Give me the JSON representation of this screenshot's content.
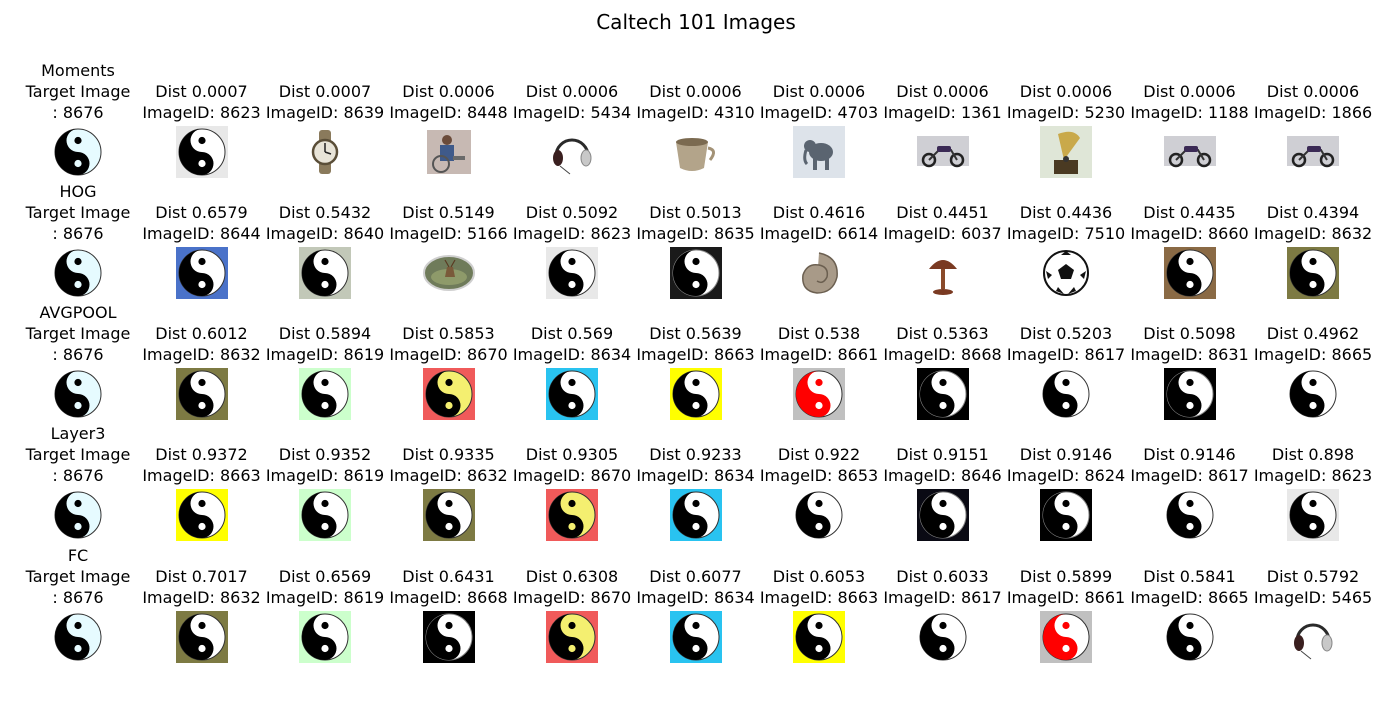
{
  "title": "Caltech 101 Images",
  "rows": [
    {
      "method": "Moments",
      "target": {
        "l1": "Target Image",
        "l2": ": 8676",
        "icon": "yinyang-icon",
        "bg": "#ffffff"
      },
      "results": [
        {
          "dist": "Dist 0.0007",
          "id": "ImageID: 8623",
          "icon": "yinyang-icon",
          "bg": "#e8e8e8"
        },
        {
          "dist": "Dist 0.0007",
          "id": "ImageID: 8639",
          "icon": "wristwatch-icon",
          "bg": "#ffffff"
        },
        {
          "dist": "Dist 0.0006",
          "id": "ImageID: 8448",
          "icon": "wheelchair-photo-icon",
          "bg": "#ffffff"
        },
        {
          "dist": "Dist 0.0006",
          "id": "ImageID: 5434",
          "icon": "headphones-icon",
          "bg": "#ffffff"
        },
        {
          "dist": "Dist 0.0006",
          "id": "ImageID: 4310",
          "icon": "cup-icon",
          "bg": "#ffffff"
        },
        {
          "dist": "Dist 0.0006",
          "id": "ImageID: 4703",
          "icon": "elephant-icon",
          "bg": "#dde3ea"
        },
        {
          "dist": "Dist 0.0006",
          "id": "ImageID: 1361",
          "icon": "motorbike-icon",
          "bg": "#ffffff"
        },
        {
          "dist": "Dist 0.0006",
          "id": "ImageID: 5230",
          "icon": "gramophone-icon",
          "bg": "#dfe6d7"
        },
        {
          "dist": "Dist 0.0006",
          "id": "ImageID: 1188",
          "icon": "motorbike-icon",
          "bg": "#ffffff"
        },
        {
          "dist": "Dist 0.0006",
          "id": "ImageID: 1866",
          "icon": "motorbike-icon",
          "bg": "#ffffff"
        }
      ]
    },
    {
      "method": "HOG",
      "target": {
        "l1": "Target Image",
        "l2": ": 8676",
        "icon": "yinyang-icon",
        "bg": "#ffffff"
      },
      "results": [
        {
          "dist": "Dist 0.6579",
          "id": "ImageID: 8644",
          "icon": "yinyang-icon",
          "bg": "#4a72c9"
        },
        {
          "dist": "Dist 0.5432",
          "id": "ImageID: 8640",
          "icon": "yinyang-icon",
          "bg": "#c2c8b8"
        },
        {
          "dist": "Dist 0.5149",
          "id": "ImageID: 5166",
          "icon": "deer-plate-icon",
          "bg": "#ffffff"
        },
        {
          "dist": "Dist 0.5092",
          "id": "ImageID: 8623",
          "icon": "yinyang-icon",
          "bg": "#e8e8e8"
        },
        {
          "dist": "Dist 0.5013",
          "id": "ImageID: 8635",
          "icon": "yinyang-icon",
          "bg": "#1a1a1a"
        },
        {
          "dist": "Dist 0.4616",
          "id": "ImageID: 6614",
          "icon": "nautilus-icon",
          "bg": "#ffffff"
        },
        {
          "dist": "Dist 0.4451",
          "id": "ImageID: 6037",
          "icon": "lamp-icon",
          "bg": "#ffffff"
        },
        {
          "dist": "Dist 0.4436",
          "id": "ImageID: 7510",
          "icon": "soccer-ball-icon",
          "bg": "#ffffff"
        },
        {
          "dist": "Dist 0.4435",
          "id": "ImageID: 8660",
          "icon": "yinyang-icon",
          "bg": "#8a6a45"
        },
        {
          "dist": "Dist 0.4394",
          "id": "ImageID: 8632",
          "icon": "yinyang-icon",
          "bg": "#7d7a43"
        }
      ]
    },
    {
      "method": "AVGPOOL",
      "target": {
        "l1": "Target Image",
        "l2": ": 8676",
        "icon": "yinyang-icon",
        "bg": "#ffffff"
      },
      "results": [
        {
          "dist": "Dist 0.6012",
          "id": "ImageID: 8632",
          "icon": "yinyang-icon",
          "bg": "#7d7a43"
        },
        {
          "dist": "Dist 0.5894",
          "id": "ImageID: 8619",
          "icon": "yinyang-icon",
          "bg": "#ccffcc"
        },
        {
          "dist": "Dist 0.5853",
          "id": "ImageID: 8670",
          "icon": "yinyang-icon",
          "bg": "#f05a5a"
        },
        {
          "dist": "Dist 0.569",
          "id": "ImageID: 8634",
          "icon": "yinyang-icon",
          "bg": "#29c3f0"
        },
        {
          "dist": "Dist 0.5639",
          "id": "ImageID: 8663",
          "icon": "yinyang-icon",
          "bg": "#ffff00"
        },
        {
          "dist": "Dist 0.538",
          "id": "ImageID: 8661",
          "icon": "yinyang-icon",
          "bg": "#c0c0c0"
        },
        {
          "dist": "Dist 0.5363",
          "id": "ImageID: 8668",
          "icon": "yinyang-icon",
          "bg": "#000000"
        },
        {
          "dist": "Dist 0.5203",
          "id": "ImageID: 8617",
          "icon": "yinyang-icon",
          "bg": "#ffffff"
        },
        {
          "dist": "Dist 0.5098",
          "id": "ImageID: 8631",
          "icon": "yinyang-icon",
          "bg": "#000000"
        },
        {
          "dist": "Dist 0.4962",
          "id": "ImageID: 8665",
          "icon": "yinyang-icon",
          "bg": "#ffffff"
        }
      ]
    },
    {
      "method": "Layer3",
      "target": {
        "l1": "Target Image",
        "l2": ": 8676",
        "icon": "yinyang-icon",
        "bg": "#ffffff"
      },
      "results": [
        {
          "dist": "Dist 0.9372",
          "id": "ImageID: 8663",
          "icon": "yinyang-icon",
          "bg": "#ffff00"
        },
        {
          "dist": "Dist 0.9352",
          "id": "ImageID: 8619",
          "icon": "yinyang-icon",
          "bg": "#ccffcc"
        },
        {
          "dist": "Dist 0.9335",
          "id": "ImageID: 8632",
          "icon": "yinyang-icon",
          "bg": "#7d7a43"
        },
        {
          "dist": "Dist 0.9305",
          "id": "ImageID: 8670",
          "icon": "yinyang-icon",
          "bg": "#f05a5a"
        },
        {
          "dist": "Dist 0.9233",
          "id": "ImageID: 8634",
          "icon": "yinyang-icon",
          "bg": "#29c3f0"
        },
        {
          "dist": "Dist 0.922",
          "id": "ImageID: 8653",
          "icon": "yinyang-icon",
          "bg": "#ffffff"
        },
        {
          "dist": "Dist 0.9151",
          "id": "ImageID: 8646",
          "icon": "yinyang-icon",
          "bg": "#0a0a14"
        },
        {
          "dist": "Dist 0.9146",
          "id": "ImageID: 8624",
          "icon": "yinyang-icon",
          "bg": "#000000"
        },
        {
          "dist": "Dist 0.9146",
          "id": "ImageID: 8617",
          "icon": "yinyang-icon",
          "bg": "#ffffff"
        },
        {
          "dist": "Dist 0.898",
          "id": "ImageID: 8623",
          "icon": "yinyang-icon",
          "bg": "#e8e8e8"
        }
      ]
    },
    {
      "method": "FC",
      "target": {
        "l1": "Target Image",
        "l2": ": 8676",
        "icon": "yinyang-icon",
        "bg": "#ffffff"
      },
      "results": [
        {
          "dist": "Dist 0.7017",
          "id": "ImageID: 8632",
          "icon": "yinyang-icon",
          "bg": "#7d7a43"
        },
        {
          "dist": "Dist 0.6569",
          "id": "ImageID: 8619",
          "icon": "yinyang-icon",
          "bg": "#ccffcc"
        },
        {
          "dist": "Dist 0.6431",
          "id": "ImageID: 8668",
          "icon": "yinyang-icon",
          "bg": "#000000"
        },
        {
          "dist": "Dist 0.6308",
          "id": "ImageID: 8670",
          "icon": "yinyang-icon",
          "bg": "#f05a5a"
        },
        {
          "dist": "Dist 0.6077",
          "id": "ImageID: 8634",
          "icon": "yinyang-icon",
          "bg": "#29c3f0"
        },
        {
          "dist": "Dist 0.6053",
          "id": "ImageID: 8663",
          "icon": "yinyang-icon",
          "bg": "#ffff00"
        },
        {
          "dist": "Dist 0.6033",
          "id": "ImageID: 8617",
          "icon": "yinyang-icon",
          "bg": "#ffffff"
        },
        {
          "dist": "Dist 0.5899",
          "id": "ImageID: 8661",
          "icon": "yinyang-icon",
          "bg": "#c0c0c0"
        },
        {
          "dist": "Dist 0.5841",
          "id": "ImageID: 8665",
          "icon": "yinyang-icon",
          "bg": "#ffffff"
        },
        {
          "dist": "Dist 0.5792",
          "id": "ImageID: 5465",
          "icon": "headphones-icon",
          "bg": "#ffffff"
        }
      ]
    }
  ]
}
